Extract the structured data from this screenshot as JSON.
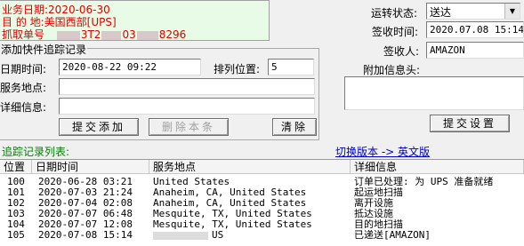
{
  "info": {
    "business_date": "业务日期:2020-06-30",
    "destination": "目 的 地:美国西部[UPS]",
    "pickup_prefix": "抓取单号",
    "pickup_part1": "3T2",
    "pickup_part2": "03",
    "pickup_suffix": "8296"
  },
  "status": {
    "transport_label": "运转状态:",
    "transport_value": "送达",
    "sign_time_label": "签收时间:",
    "sign_time_value": "2020.07.08 15:14",
    "signer_label": "签收人:",
    "signer_value": "AMAZON",
    "extra_info_label": "附加信息头:",
    "extra_info_value": "",
    "submit_settings": "提交设置"
  },
  "add_track": {
    "title": "添加快件追踪记录",
    "datetime_label": "日期时间:",
    "datetime_value": "2020-08-22 09:22",
    "sort_label": "排列位置:",
    "sort_value": "5",
    "location_label": "服务地点:",
    "location_value": "",
    "detail_label": "详细信息:",
    "detail_value": "",
    "add_button": "提交添加",
    "delete_button": "删除本条",
    "clear_button": "清除"
  },
  "list": {
    "title": "追踪记录列表:",
    "switch_link": "切换版本 -> 英文版",
    "columns": [
      "位置",
      "日期时间",
      "服务地点",
      "详细信息"
    ],
    "rows": [
      {
        "pos": "100",
        "datetime": "2020-06-28 03:21",
        "location": "United States",
        "detail": "订单已处理: 为 UPS 准备就绪"
      },
      {
        "pos": "101",
        "datetime": "2020-07-03 21:24",
        "location": "Anaheim, CA, United States",
        "detail": "起运地扫描"
      },
      {
        "pos": "102",
        "datetime": "2020-07-04 02:08",
        "location": "Anaheim, CA, United States",
        "detail": "离开设施"
      },
      {
        "pos": "103",
        "datetime": "2020-07-07 06:48",
        "location": "Mesquite, TX, United States",
        "detail": "抵达设施"
      },
      {
        "pos": "104",
        "datetime": "2020-07-07 12:08",
        "location": "Mesquite, TX, United States",
        "detail": "目的地扫描"
      },
      {
        "pos": "105",
        "datetime": "2020-07-08 15:14",
        "location": "US",
        "detail": "已递送[AMAZON]"
      }
    ]
  }
}
